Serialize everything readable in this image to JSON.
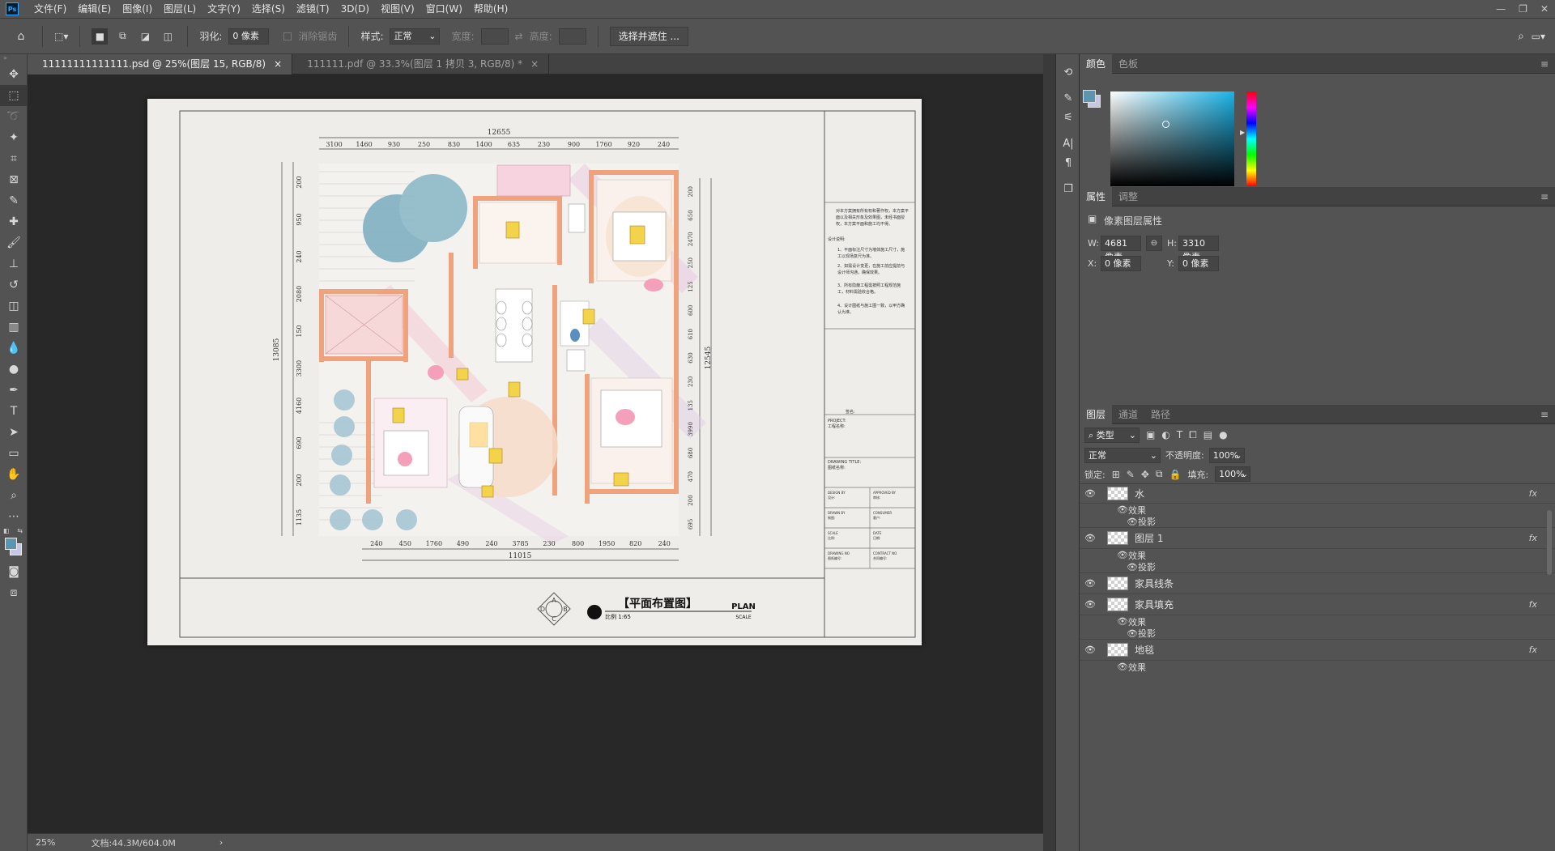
{
  "menubar": {
    "app_badge": "Ps",
    "items": [
      "文件(F)",
      "编辑(E)",
      "图像(I)",
      "图层(L)",
      "文字(Y)",
      "选择(S)",
      "滤镜(T)",
      "3D(D)",
      "视图(V)",
      "窗口(W)",
      "帮助(H)"
    ]
  },
  "options": {
    "feather_label": "羽化:",
    "feather_value": "0 像素",
    "antialias_label": "消除锯齿",
    "style_label": "样式:",
    "style_value": "正常",
    "width_label": "宽度:",
    "height_label": "高度:",
    "select_mask_button": "选择并遮住 ..."
  },
  "tabs": [
    {
      "label": "11111111111111.psd @ 25%(图层 15, RGB/8)",
      "close": "×"
    },
    {
      "label": "111111.pdf @ 33.3%(图层 1 拷贝 3, RGB/8) *",
      "close": "×"
    }
  ],
  "status": {
    "zoom": "25%",
    "doc": "文档:44.3M/604.0M"
  },
  "color_panel": {
    "tabs": [
      "颜色",
      "色板"
    ],
    "foreground": "#5b95b0"
  },
  "properties_panel": {
    "tabs": [
      "属性",
      "调整"
    ],
    "title": "像素图层属性",
    "w_label": "W:",
    "w_value": "4681 像素",
    "h_label": "H:",
    "h_value": "3310 像素",
    "x_label": "X:",
    "x_value": "0 像素",
    "y_label": "Y:",
    "y_value": "0 像素"
  },
  "layers_panel": {
    "tabs": [
      "图层",
      "通道",
      "路径"
    ],
    "filter_value": "类型",
    "blend_mode": "正常",
    "opacity_label": "不透明度:",
    "opacity_value": "100%",
    "lock_label": "锁定:",
    "fill_label": "填充:",
    "fill_value": "100%",
    "layers": [
      {
        "name": "水",
        "fx": "fx",
        "effects_label": "效果",
        "effect": "投影"
      },
      {
        "name": "图层 1",
        "fx": "fx",
        "effects_label": "效果",
        "effect": "投影"
      },
      {
        "name": "家具线条"
      },
      {
        "name": "家具填充",
        "fx": "fx",
        "effects_label": "效果",
        "effect": "投影"
      },
      {
        "name": "地毯",
        "fx": "fx",
        "effects_label": "效果"
      }
    ]
  },
  "drawing": {
    "top_total": "12655",
    "top_dims": [
      "3100",
      "1460",
      "930",
      "250",
      "830",
      "1400",
      "635",
      "230",
      "900",
      "1760",
      "920",
      "240"
    ],
    "bottom_total": "11015",
    "bottom_dims": [
      "240",
      "450",
      "1760",
      "490",
      "240",
      "3785",
      "230",
      "800",
      "1950",
      "820",
      "240"
    ],
    "left_total": "13085",
    "left_dims": [
      "200",
      "950",
      "240",
      "2080",
      "150",
      "3300",
      "4160",
      "690",
      "200",
      "1135"
    ],
    "right_total": "12545",
    "right_dims": [
      "200",
      "650",
      "2470",
      "250",
      "125",
      "600",
      "610",
      "630",
      "230",
      "135",
      "3990",
      "680",
      "470",
      "200",
      "695"
    ],
    "title": "【平面布置图】",
    "title_en": "PLAN",
    "scale": "比例 1:65",
    "scale_en": "SCALE",
    "notes": "对本方案拥有所有权和著作权，本方案平面以及相关形象及效果图，未经书面授权，本方案平面和施工均不得。",
    "design_label": "设计说明:",
    "design_notes": [
      "1、平面标注尺寸为墙体施工尺寸，施工以现场复尺为准。",
      "2、如需设计变更，在施工前应提前与设计师沟通，确保效果。",
      "3、所有隐蔽工程需按照工程规范施工，材料需验收合格。",
      "4、设计图纸与施工图一致，以甲方确认为准。"
    ],
    "title_block": {
      "project": "PROJECT:",
      "project_cn": "工程名称:",
      "drawing_title": "DRAWING TITLE:",
      "drawing_title_cn": "图纸名称:",
      "design_by": "DESIGN BY",
      "design_by_cn": "设计:",
      "approved_by": "APPROVED BY",
      "approved_by_cn": "审核:",
      "drawn_by": "DRAWN BY",
      "drawn_by_cn": "制图:",
      "consumer": "CONSUMER",
      "consumer_cn": "客户:",
      "scale": "SCALE",
      "scale_cn": "比例:",
      "date": "DATE",
      "date_cn": "日期:",
      "drawing_no": "DRAWING NO",
      "drawing_no_cn": "图纸编号:",
      "contract_no": "CONTRACT NO",
      "contract_no_cn": "合同编号:",
      "sign_label": "签名:",
      "compass": [
        "A",
        "B",
        "C",
        "D"
      ]
    }
  }
}
